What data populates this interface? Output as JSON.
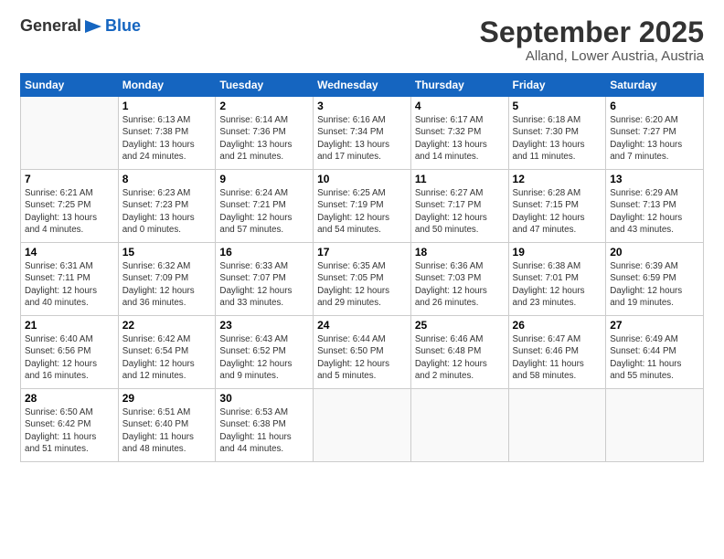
{
  "logo": {
    "general": "General",
    "blue": "Blue"
  },
  "header": {
    "title": "September 2025",
    "subtitle": "Alland, Lower Austria, Austria"
  },
  "weekdays": [
    "Sunday",
    "Monday",
    "Tuesday",
    "Wednesday",
    "Thursday",
    "Friday",
    "Saturday"
  ],
  "weeks": [
    [
      {
        "day": "",
        "info": ""
      },
      {
        "day": "1",
        "info": "Sunrise: 6:13 AM\nSunset: 7:38 PM\nDaylight: 13 hours\nand 24 minutes."
      },
      {
        "day": "2",
        "info": "Sunrise: 6:14 AM\nSunset: 7:36 PM\nDaylight: 13 hours\nand 21 minutes."
      },
      {
        "day": "3",
        "info": "Sunrise: 6:16 AM\nSunset: 7:34 PM\nDaylight: 13 hours\nand 17 minutes."
      },
      {
        "day": "4",
        "info": "Sunrise: 6:17 AM\nSunset: 7:32 PM\nDaylight: 13 hours\nand 14 minutes."
      },
      {
        "day": "5",
        "info": "Sunrise: 6:18 AM\nSunset: 7:30 PM\nDaylight: 13 hours\nand 11 minutes."
      },
      {
        "day": "6",
        "info": "Sunrise: 6:20 AM\nSunset: 7:27 PM\nDaylight: 13 hours\nand 7 minutes."
      }
    ],
    [
      {
        "day": "7",
        "info": "Sunrise: 6:21 AM\nSunset: 7:25 PM\nDaylight: 13 hours\nand 4 minutes."
      },
      {
        "day": "8",
        "info": "Sunrise: 6:23 AM\nSunset: 7:23 PM\nDaylight: 13 hours\nand 0 minutes."
      },
      {
        "day": "9",
        "info": "Sunrise: 6:24 AM\nSunset: 7:21 PM\nDaylight: 12 hours\nand 57 minutes."
      },
      {
        "day": "10",
        "info": "Sunrise: 6:25 AM\nSunset: 7:19 PM\nDaylight: 12 hours\nand 54 minutes."
      },
      {
        "day": "11",
        "info": "Sunrise: 6:27 AM\nSunset: 7:17 PM\nDaylight: 12 hours\nand 50 minutes."
      },
      {
        "day": "12",
        "info": "Sunrise: 6:28 AM\nSunset: 7:15 PM\nDaylight: 12 hours\nand 47 minutes."
      },
      {
        "day": "13",
        "info": "Sunrise: 6:29 AM\nSunset: 7:13 PM\nDaylight: 12 hours\nand 43 minutes."
      }
    ],
    [
      {
        "day": "14",
        "info": "Sunrise: 6:31 AM\nSunset: 7:11 PM\nDaylight: 12 hours\nand 40 minutes."
      },
      {
        "day": "15",
        "info": "Sunrise: 6:32 AM\nSunset: 7:09 PM\nDaylight: 12 hours\nand 36 minutes."
      },
      {
        "day": "16",
        "info": "Sunrise: 6:33 AM\nSunset: 7:07 PM\nDaylight: 12 hours\nand 33 minutes."
      },
      {
        "day": "17",
        "info": "Sunrise: 6:35 AM\nSunset: 7:05 PM\nDaylight: 12 hours\nand 29 minutes."
      },
      {
        "day": "18",
        "info": "Sunrise: 6:36 AM\nSunset: 7:03 PM\nDaylight: 12 hours\nand 26 minutes."
      },
      {
        "day": "19",
        "info": "Sunrise: 6:38 AM\nSunset: 7:01 PM\nDaylight: 12 hours\nand 23 minutes."
      },
      {
        "day": "20",
        "info": "Sunrise: 6:39 AM\nSunset: 6:59 PM\nDaylight: 12 hours\nand 19 minutes."
      }
    ],
    [
      {
        "day": "21",
        "info": "Sunrise: 6:40 AM\nSunset: 6:56 PM\nDaylight: 12 hours\nand 16 minutes."
      },
      {
        "day": "22",
        "info": "Sunrise: 6:42 AM\nSunset: 6:54 PM\nDaylight: 12 hours\nand 12 minutes."
      },
      {
        "day": "23",
        "info": "Sunrise: 6:43 AM\nSunset: 6:52 PM\nDaylight: 12 hours\nand 9 minutes."
      },
      {
        "day": "24",
        "info": "Sunrise: 6:44 AM\nSunset: 6:50 PM\nDaylight: 12 hours\nand 5 minutes."
      },
      {
        "day": "25",
        "info": "Sunrise: 6:46 AM\nSunset: 6:48 PM\nDaylight: 12 hours\nand 2 minutes."
      },
      {
        "day": "26",
        "info": "Sunrise: 6:47 AM\nSunset: 6:46 PM\nDaylight: 11 hours\nand 58 minutes."
      },
      {
        "day": "27",
        "info": "Sunrise: 6:49 AM\nSunset: 6:44 PM\nDaylight: 11 hours\nand 55 minutes."
      }
    ],
    [
      {
        "day": "28",
        "info": "Sunrise: 6:50 AM\nSunset: 6:42 PM\nDaylight: 11 hours\nand 51 minutes."
      },
      {
        "day": "29",
        "info": "Sunrise: 6:51 AM\nSunset: 6:40 PM\nDaylight: 11 hours\nand 48 minutes."
      },
      {
        "day": "30",
        "info": "Sunrise: 6:53 AM\nSunset: 6:38 PM\nDaylight: 11 hours\nand 44 minutes."
      },
      {
        "day": "",
        "info": ""
      },
      {
        "day": "",
        "info": ""
      },
      {
        "day": "",
        "info": ""
      },
      {
        "day": "",
        "info": ""
      }
    ]
  ]
}
